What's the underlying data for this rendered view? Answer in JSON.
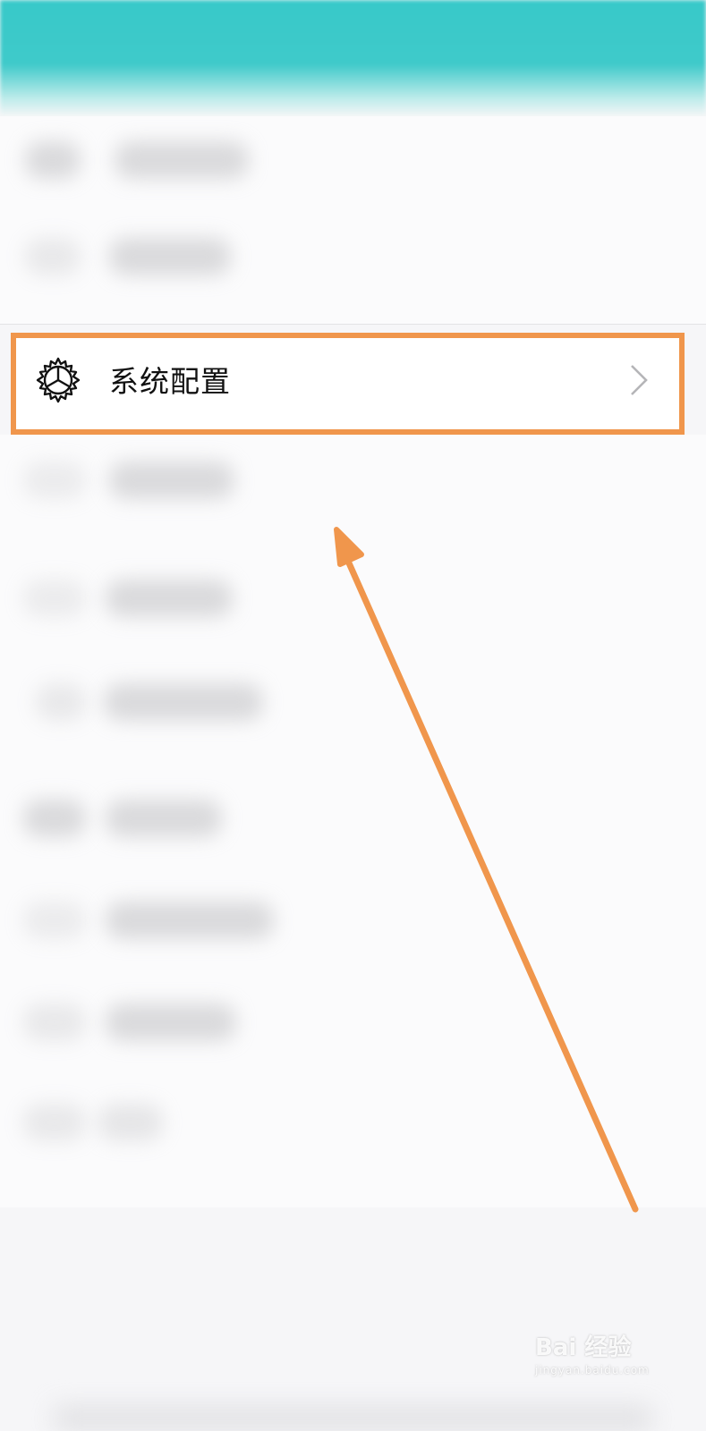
{
  "settings_item": {
    "label": "系统配置",
    "icon": "gear-icon",
    "chevron": "chevron-right-icon"
  },
  "annotation": {
    "highlight_color": "#f0964c",
    "arrow_color": "#f0964c"
  },
  "watermark": {
    "main": "Bai 经验",
    "sub": "jingyan.baidu.com"
  },
  "colors": {
    "header": "#3fcaca",
    "background": "#f6f6f8"
  }
}
